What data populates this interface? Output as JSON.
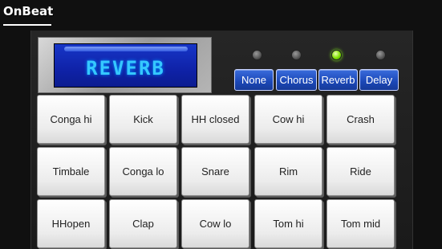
{
  "app": {
    "title": "OnBeat"
  },
  "display": {
    "text": "REVERB"
  },
  "effects": {
    "buttons": [
      {
        "label": "None",
        "active": false
      },
      {
        "label": "Chorus",
        "active": false
      },
      {
        "label": "Reverb",
        "active": true
      },
      {
        "label": "Delay",
        "active": false
      }
    ],
    "led_on_color": "#7fe000",
    "led_off_color": "#6a6a6a"
  },
  "pads": {
    "rows": [
      [
        "Conga hi",
        "Kick",
        "HH closed",
        "Cow hi",
        "Crash"
      ],
      [
        "Timbale",
        "Conga lo",
        "Snare",
        "Rim",
        "Ride"
      ],
      [
        "HHopen",
        "Clap",
        "Cow lo",
        "Tom hi",
        "Tom mid"
      ]
    ]
  },
  "colors": {
    "background": "#101010",
    "lcd_background": "#1736c8",
    "lcd_text": "#35c8ff",
    "fx_button": "#1b47b6",
    "pad": "#efefef"
  }
}
